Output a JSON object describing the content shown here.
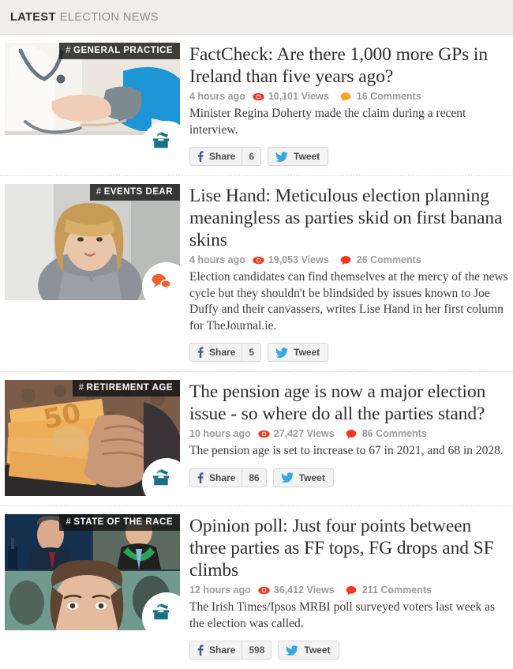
{
  "header": {
    "strong": "LATEST",
    "light": "ELECTION NEWS"
  },
  "icons": {
    "eye": "eye-icon",
    "comment": "comment-bubble-icon",
    "facebook": "facebook-icon",
    "twitter": "twitter-bird-icon",
    "ballot": "ballot-box-icon",
    "speech": "speech-bubbles-icon",
    "hash": "#"
  },
  "colors": {
    "header_bg": "#efeeec",
    "eye_red": "#f4371f",
    "comment_orange": "#f7a41d",
    "comment_red": "#f4371f",
    "meta_gray": "#9b9b9b",
    "ballot_teal": "#1a7186",
    "speech_orange": "#e8622a",
    "facebook_blue": "#3b5998",
    "twitter_blue": "#38a8e0"
  },
  "labels": {
    "share": "Share",
    "tweet": "Tweet",
    "views_suffix": "Views",
    "comments_suffix": "Comments"
  },
  "articles": [
    {
      "category": "GENERAL PRACTICE",
      "headline": "FactCheck: Are there 1,000 more GPs in Ireland than five years ago?",
      "time": "4 hours ago",
      "views": "10,101",
      "comments": "16",
      "standfirst": "Minister Regina Doherty made the claim during a recent interview.",
      "share_count": "6",
      "badge": "ballot-box-icon",
      "comment_color": "#f7a41d",
      "image_alt": "doctor-taking-blood-pressure-photo"
    },
    {
      "category": "EVENTS DEAR",
      "headline": "Lise Hand: Meticulous election planning meaningless as parties skid on first banana skins",
      "time": "4 hours ago",
      "views": "19,053",
      "comments": "26",
      "standfirst": "Election candidates can find themselves at the mercy of the news cycle but they shouldn't be blindsided by issues known to Joe Duffy and their canvassers, writes Lise Hand in her first column for TheJournal.ie.",
      "share_count": "5",
      "badge": "speech-bubbles-icon",
      "comment_color": "#f4371f",
      "image_alt": "blonde-woman-portrait-photo"
    },
    {
      "category": "RETIREMENT AGE",
      "headline": "The pension age is now a major election issue - so where do all the parties stand?",
      "time": "10 hours ago",
      "views": "27,427",
      "comments": "86",
      "standfirst": "The pension age is set to increase to 67 in 2021, and 68 in 2028.",
      "share_count": "86",
      "badge": "ballot-box-icon",
      "comment_color": "#f4371f",
      "image_alt": "elderly-hands-holding-50-euro-notes-photo"
    },
    {
      "category": "STATE OF THE RACE",
      "headline": "Opinion poll: Just four points between three parties as FF tops, FG drops and SF climbs",
      "time": "12 hours ago",
      "views": "36,412",
      "comments": "211",
      "standfirst": "The Irish Times/Ipsos MRBI poll surveyed voters last week as the election was called.",
      "share_count": "598",
      "badge": "ballot-box-icon",
      "comment_color": "#f4371f",
      "image_alt": "three-party-leaders-composite-photo"
    }
  ]
}
